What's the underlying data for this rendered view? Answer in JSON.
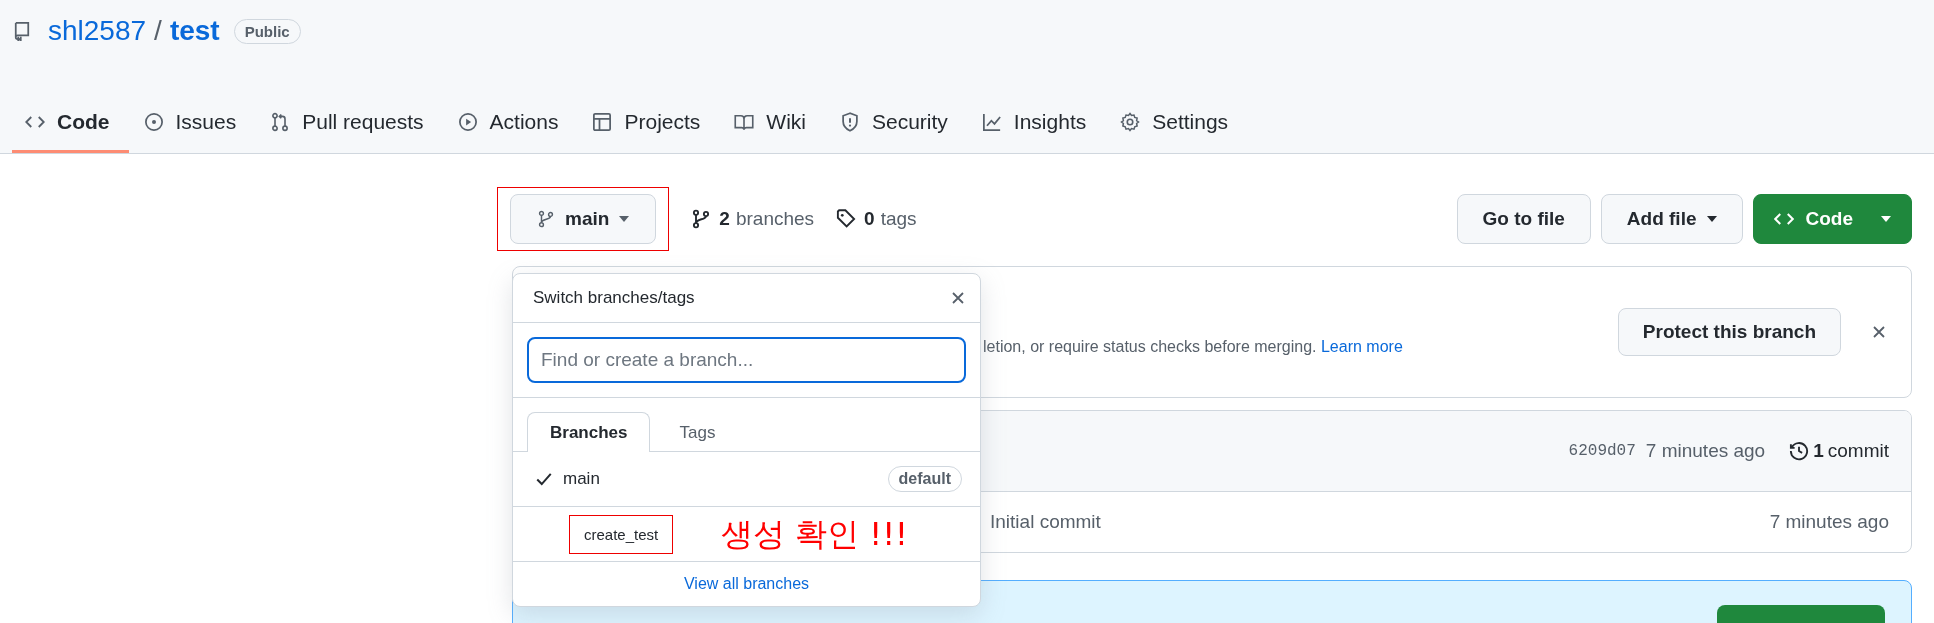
{
  "repo": {
    "owner": "shl2587",
    "separator": "/",
    "name": "test",
    "visibility": "Public"
  },
  "tabs": [
    {
      "label": "Code",
      "kind": "code",
      "selected": true
    },
    {
      "label": "Issues",
      "kind": "issues",
      "selected": false
    },
    {
      "label": "Pull requests",
      "kind": "pulls",
      "selected": false
    },
    {
      "label": "Actions",
      "kind": "actions",
      "selected": false
    },
    {
      "label": "Projects",
      "kind": "projects",
      "selected": false
    },
    {
      "label": "Wiki",
      "kind": "wiki",
      "selected": false
    },
    {
      "label": "Security",
      "kind": "security",
      "selected": false
    },
    {
      "label": "Insights",
      "kind": "insights",
      "selected": false
    },
    {
      "label": "Settings",
      "kind": "settings",
      "selected": false
    }
  ],
  "branch_bar": {
    "current_branch": "main",
    "branches_count": "2",
    "branches_label": "branches",
    "tags_count": "0",
    "tags_label": "tags"
  },
  "actions": [
    {
      "label": "Go to file",
      "kind": "plain"
    },
    {
      "label": "Add file",
      "kind": "menu"
    },
    {
      "label": "Code",
      "kind": "primary"
    }
  ],
  "banner": {
    "text": "letion, or require status checks before merging.",
    "link": "Learn more",
    "button": "Protect this branch"
  },
  "commits": {
    "hash": "6209d07",
    "time": "7 minutes ago",
    "count": "1",
    "count_label": "commit"
  },
  "files": [
    {
      "message": "Initial commit",
      "time": "7 minutes ago"
    }
  ],
  "branch_menu": {
    "title": "Switch branches/tags",
    "placeholder": "Find or create a branch...",
    "tabs": [
      {
        "label": "Branches",
        "selected": true
      },
      {
        "label": "Tags",
        "selected": false
      }
    ],
    "branches": [
      {
        "name": "main",
        "selected": true,
        "badge": "default"
      },
      {
        "name": "create_test",
        "selected": false
      }
    ],
    "footer_link": "View all branches"
  },
  "annotation": {
    "text": "생성 확인 !!!"
  }
}
